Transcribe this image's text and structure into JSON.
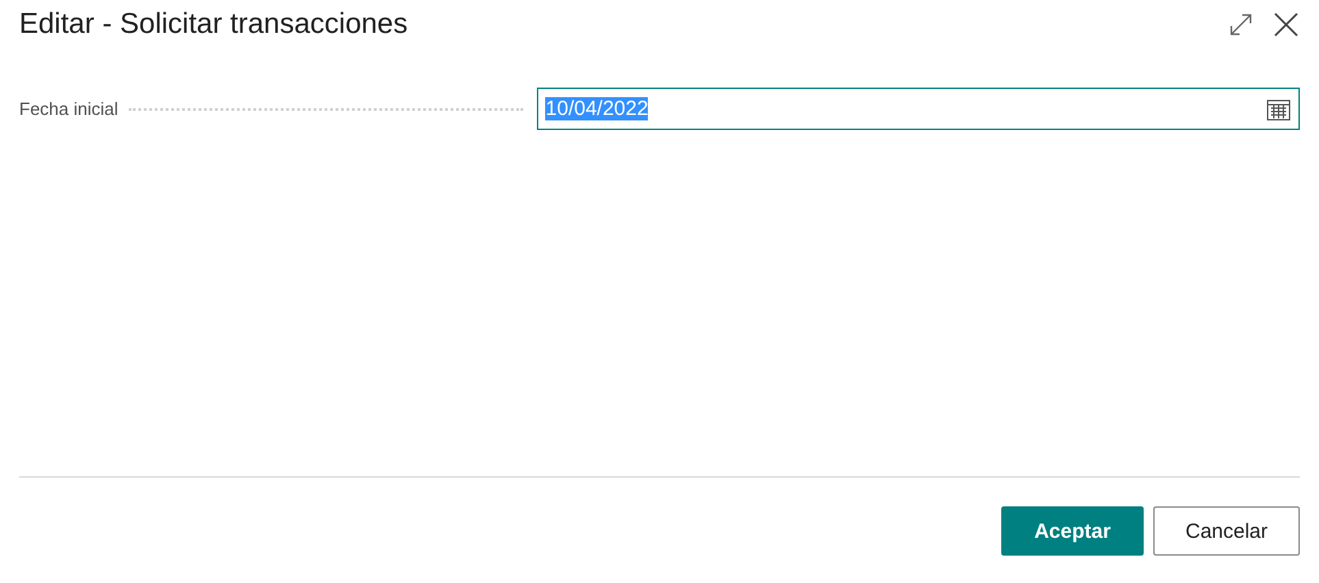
{
  "dialog": {
    "title": "Editar - Solicitar transacciones"
  },
  "fields": [
    {
      "label": "Fecha inicial",
      "value": "10/04/2022",
      "text_selected": true
    }
  ],
  "buttons": [
    {
      "label": "Aceptar",
      "kind": "primary"
    },
    {
      "label": "Cancelar",
      "kind": "secondary"
    }
  ]
}
